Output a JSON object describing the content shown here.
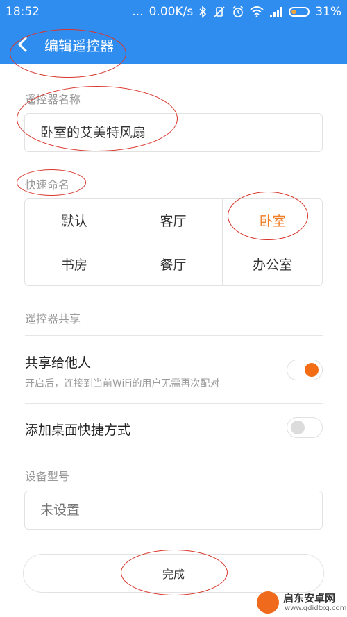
{
  "status_bar": {
    "time": "18:52",
    "dots": "...",
    "net_speed": "0.00K/s",
    "battery": "31%",
    "battery_level": 0.31
  },
  "header": {
    "title": "编辑遥控器"
  },
  "name_section": {
    "label": "遥控器名称",
    "value": "卧室的艾美特风扇"
  },
  "quick_name": {
    "label": "快速命名",
    "options": [
      "默认",
      "客厅",
      "卧室",
      "书房",
      "餐厅",
      "办公室"
    ],
    "selected": "卧室"
  },
  "share_section": {
    "label": "遥控器共享",
    "share_title": "共享给他人",
    "share_desc": "开启后，连接到当前WiFi的用户无需再次配对",
    "share_enabled": true,
    "shortcut_title": "添加桌面快捷方式",
    "shortcut_enabled": false
  },
  "device_section": {
    "label": "设备型号",
    "placeholder": "未设置"
  },
  "done_button": {
    "label": "完成"
  },
  "watermark": {
    "name": "启东安卓网",
    "url": "www.qdidtxq.com"
  },
  "colors": {
    "primary": "#2f8df0",
    "accent": "#f07e28",
    "annotation": "#d9362b"
  }
}
